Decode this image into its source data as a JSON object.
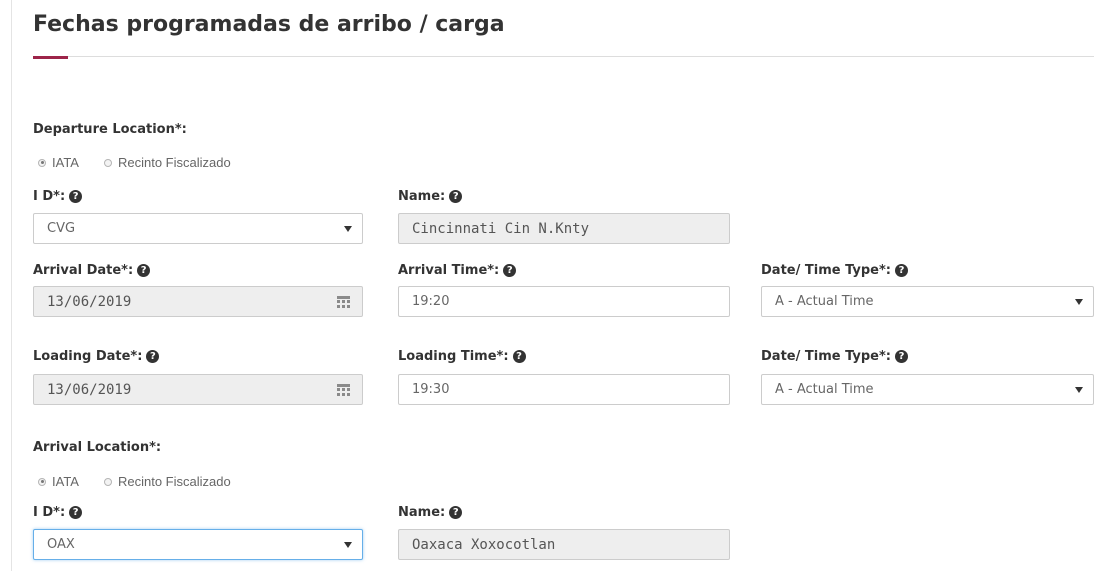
{
  "page": {
    "title": "Fechas programadas de arribo / carga",
    "accent_color": "#9d2449"
  },
  "departure": {
    "section_label": "Departure Location*:",
    "radio_options": [
      {
        "label": "IATA",
        "checked": true
      },
      {
        "label": "Recinto Fiscalizado",
        "checked": false
      }
    ],
    "id_label": "I D*:",
    "id_value": "CVG",
    "name_label": "Name:",
    "name_value": "Cincinnati Cin N.Knty"
  },
  "arrival_schedule": {
    "date_label": "Arrival Date*:",
    "date_value": "13/06/2019",
    "time_label": "Arrival Time*:",
    "time_value": "19:20",
    "type_label": "Date/ Time Type*:",
    "type_value": "A - Actual Time"
  },
  "loading_schedule": {
    "date_label": "Loading Date*:",
    "date_value": "13/06/2019",
    "time_label": "Loading Time*:",
    "time_value": "19:30",
    "type_label": "Date/ Time Type*:",
    "type_value": "A - Actual Time"
  },
  "arrival_location": {
    "section_label": "Arrival Location*:",
    "radio_options": [
      {
        "label": "IATA",
        "checked": true
      },
      {
        "label": "Recinto Fiscalizado",
        "checked": false
      }
    ],
    "id_label": "I D*:",
    "id_value": "OAX",
    "name_label": "Name:",
    "name_value": "Oaxaca Xoxocotlan"
  },
  "icons": {
    "help": "question-circle-icon",
    "calendar": "calendar-icon",
    "dropdown": "caret-down-icon",
    "help_glyph": "?"
  }
}
